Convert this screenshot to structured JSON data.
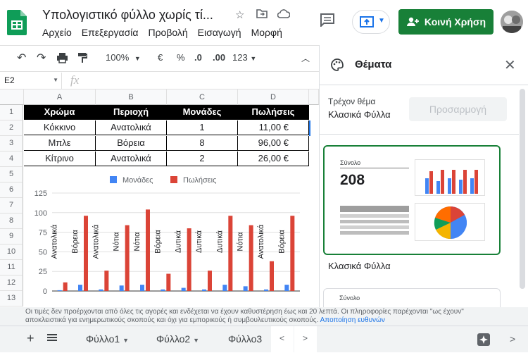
{
  "app": {
    "title": "Υπολογιστικό φύλλο χωρίς τί..."
  },
  "menu": [
    "Αρχείο",
    "Επεξεργασία",
    "Προβολή",
    "Εισαγωγή",
    "Μορφή"
  ],
  "share": {
    "label": "Κοινή Χρήση"
  },
  "toolbar": {
    "zoom": "100%",
    "currency": "€",
    "percent": "%",
    "dec_less": ".0",
    "dec_more": ".00",
    "format": "123"
  },
  "formula": {
    "namebox": "E2",
    "fx": "fx"
  },
  "columns": [
    "A",
    "B",
    "C",
    "D"
  ],
  "rows": [
    "1",
    "2",
    "3",
    "4",
    "5",
    "6",
    "7",
    "8",
    "9",
    "10",
    "11",
    "12",
    "13"
  ],
  "table": {
    "headers": [
      "Χρώμα",
      "Περιοχή",
      "Μονάδες",
      "Πωλήσεις"
    ],
    "rows": [
      [
        "Κόκκινο",
        "Ανατολικά",
        "1",
        "11,00 €"
      ],
      [
        "Μπλε",
        "Βόρεια",
        "8",
        "96,00 €"
      ],
      [
        "Κίτρινο",
        "Ανατολικά",
        "2",
        "26,00 €"
      ]
    ]
  },
  "chart_data": {
    "type": "bar",
    "series": [
      {
        "name": "Μονάδες",
        "color": "#4285f4",
        "values": [
          1,
          8,
          2,
          7,
          8,
          2,
          4,
          2,
          8,
          6,
          2,
          8
        ]
      },
      {
        "name": "Πωλήσεις",
        "color": "#db4437",
        "values": [
          11,
          96,
          26,
          84,
          104,
          22,
          80,
          26,
          96,
          84,
          38,
          96
        ]
      }
    ],
    "labels": [
      "Ανατολικά",
      "Βόρεια",
      "Ανατολικά",
      "Νότια",
      "Νότια",
      "Βόρεια",
      "Δυτικά",
      "Δυτικά",
      "Δυτικά",
      "Νότια",
      "Ανατολικά",
      "Βόρεια"
    ],
    "yticks": [
      "0",
      "25",
      "50",
      "75",
      "100",
      "125"
    ],
    "ylim": [
      0,
      125
    ]
  },
  "sidebar": {
    "title": "Θέματα",
    "current_label": "Τρέχον θέμα",
    "current_value": "Κλασικά Φύλλα",
    "customize": "Προσαρμογή",
    "preview_total_label": "Σύνολο",
    "preview_total": "208",
    "theme_name": "Κλασικά Φύλλα",
    "next_preview_label": "Σύνολο"
  },
  "disclaimer": {
    "line1": "Οι τιμές δεν προέρχονται από όλες τις αγορές και ενδέχεται να έχουν καθυστέρηση έως και 20 λεπτά. Οι πληροφορίες παρέχονται \"ως έχουν\"",
    "line2": "αποκλειστικά για ενημερωτικούς σκοπούς και όχι για εμπορικούς ή συμβουλευτικούς σκοπούς.",
    "link": "Αποποίηση ευθυνών"
  },
  "sheets": [
    "Φύλλο1",
    "Φύλλο2",
    "Φύλλο3"
  ]
}
